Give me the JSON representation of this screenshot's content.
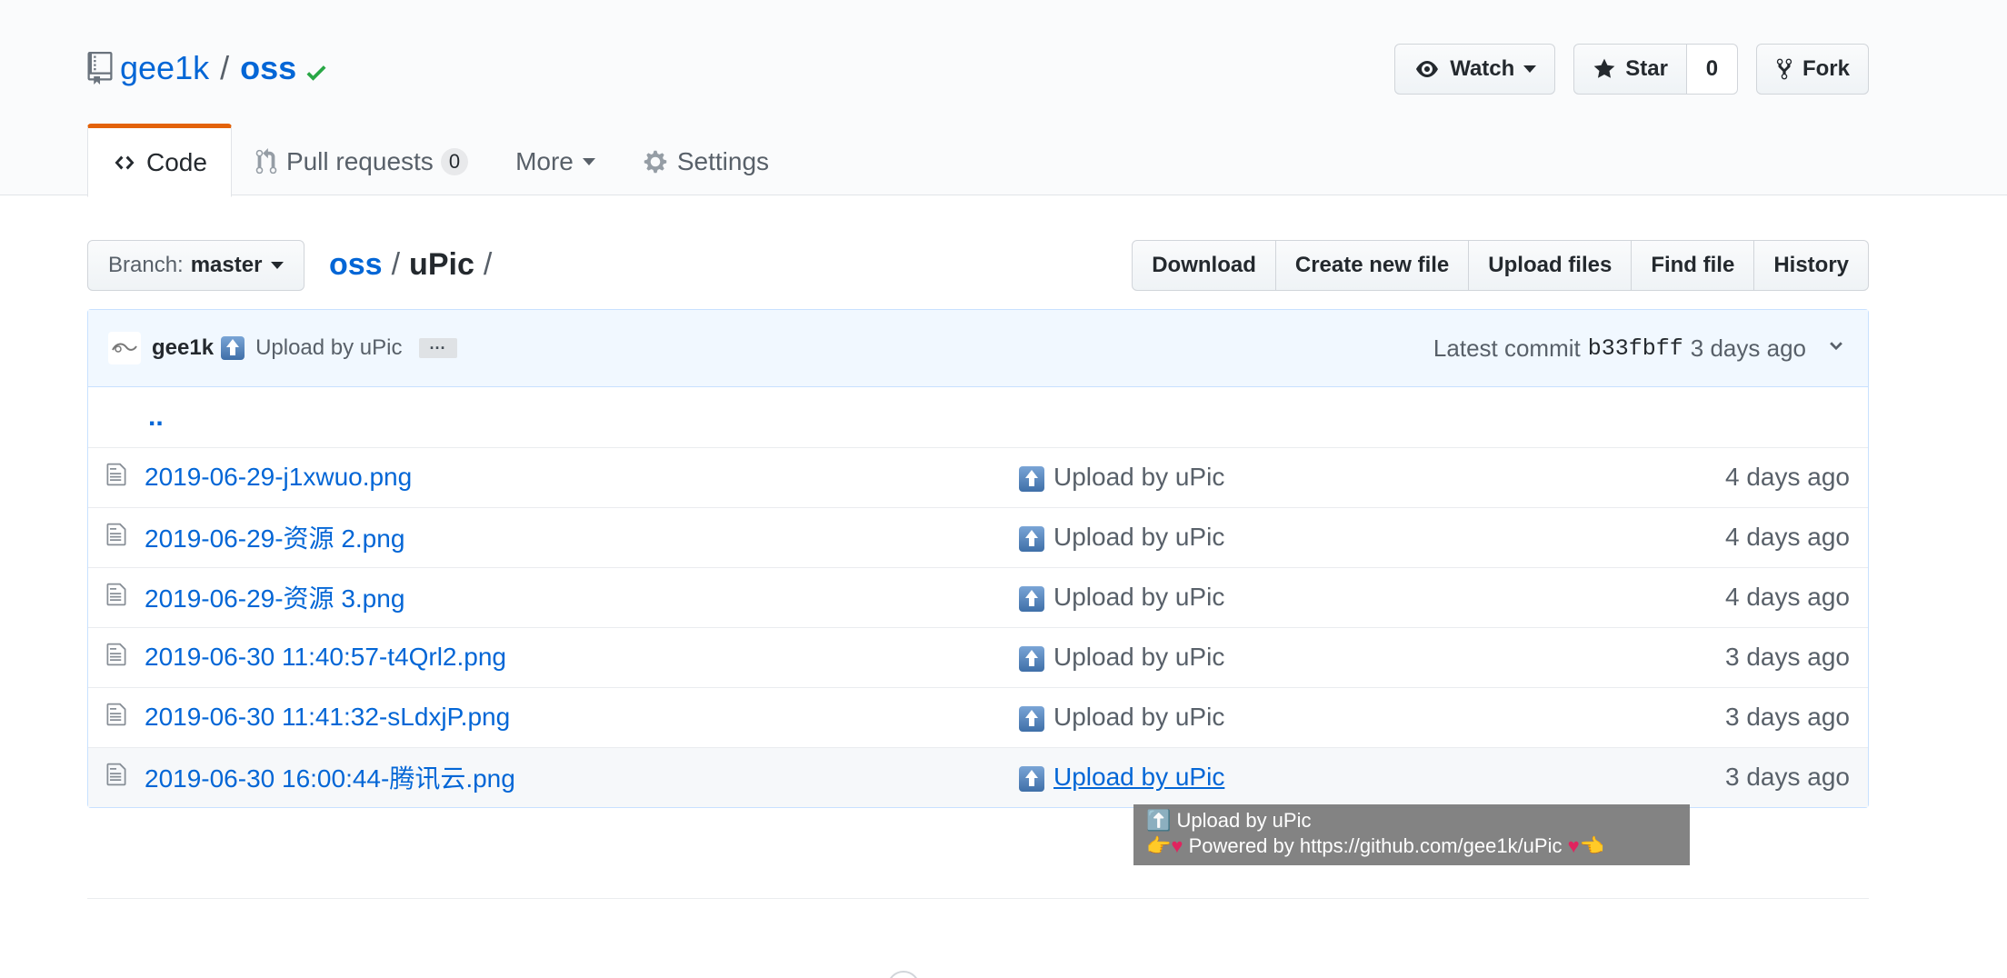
{
  "repo": {
    "owner": "gee1k",
    "separator": "/",
    "name": "oss"
  },
  "actions": {
    "watch_label": "Watch",
    "star_label": "Star",
    "star_count": "0",
    "fork_label": "Fork"
  },
  "nav": {
    "code": "Code",
    "pull_requests": "Pull requests",
    "pull_requests_count": "0",
    "more": "More",
    "settings": "Settings"
  },
  "branch": {
    "prefix": "Branch:",
    "name": "master"
  },
  "breadcrumb": {
    "root": "oss",
    "sep": "/",
    "current": "uPic",
    "trailing": "/"
  },
  "file_actions": [
    "Download",
    "Create new file",
    "Upload files",
    "Find file",
    "History"
  ],
  "commit": {
    "author": "gee1k",
    "message": "Upload by uPic",
    "ellipsis": "···",
    "latest_label": "Latest commit",
    "sha": "b33fbff",
    "age": "3 days ago"
  },
  "up_link": "..",
  "files": [
    {
      "name": "2019-06-29-j1xwuo.png",
      "message": "Upload by uPic",
      "age": "4 days ago"
    },
    {
      "name": "2019-06-29-资源 2.png",
      "message": "Upload by uPic",
      "age": "4 days ago"
    },
    {
      "name": "2019-06-29-资源 3.png",
      "message": "Upload by uPic",
      "age": "4 days ago"
    },
    {
      "name": "2019-06-30 11:40:57-t4Qrl2.png",
      "message": "Upload by uPic",
      "age": "3 days ago"
    },
    {
      "name": "2019-06-30 11:41:32-sLdxjP.png",
      "message": "Upload by uPic",
      "age": "3 days ago"
    },
    {
      "name": "2019-06-30 16:00:44-腾讯云.png",
      "message": "Upload by uPic",
      "age": "3 days ago"
    }
  ],
  "tooltip": {
    "line1": "⬆️ Upload by uPic",
    "line2_pre": "👉",
    "line2_text": " Powered by https://github.com/gee1k/uPic ",
    "line2_post": "👈"
  },
  "colors": {
    "link": "#0366d6",
    "accent_tab": "#e36209",
    "check": "#28a745"
  }
}
